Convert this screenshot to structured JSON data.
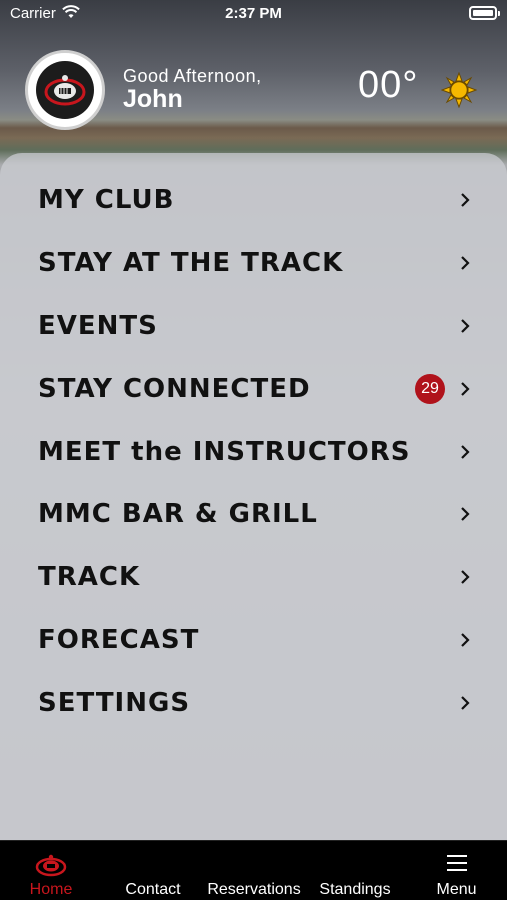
{
  "status_bar": {
    "carrier": "Carrier",
    "time": "2:37 PM"
  },
  "header": {
    "greeting": "Good Afternoon,",
    "name": "John",
    "temperature": "00°",
    "weather_icon": "sun-icon"
  },
  "menu": {
    "items": [
      {
        "label": "MY CLUB"
      },
      {
        "label": "STAY AT THE TRACK"
      },
      {
        "label": "EVENTS"
      },
      {
        "label": "STAY CONNECTED",
        "badge": "29"
      },
      {
        "label": "MEET the INSTRUCTORS"
      },
      {
        "label": "MMC BAR & GRILL"
      },
      {
        "label": "TRACK"
      },
      {
        "label": "FORECAST"
      },
      {
        "label": "SETTINGS"
      }
    ]
  },
  "tabbar": {
    "tabs": [
      {
        "label": "Home",
        "active": true
      },
      {
        "label": "Contact"
      },
      {
        "label": "Reservations"
      },
      {
        "label": "Standings"
      },
      {
        "label": "Menu"
      }
    ]
  },
  "colors": {
    "accent": "#c8161d",
    "badge": "#b0121b",
    "tabbar": "#000000"
  }
}
